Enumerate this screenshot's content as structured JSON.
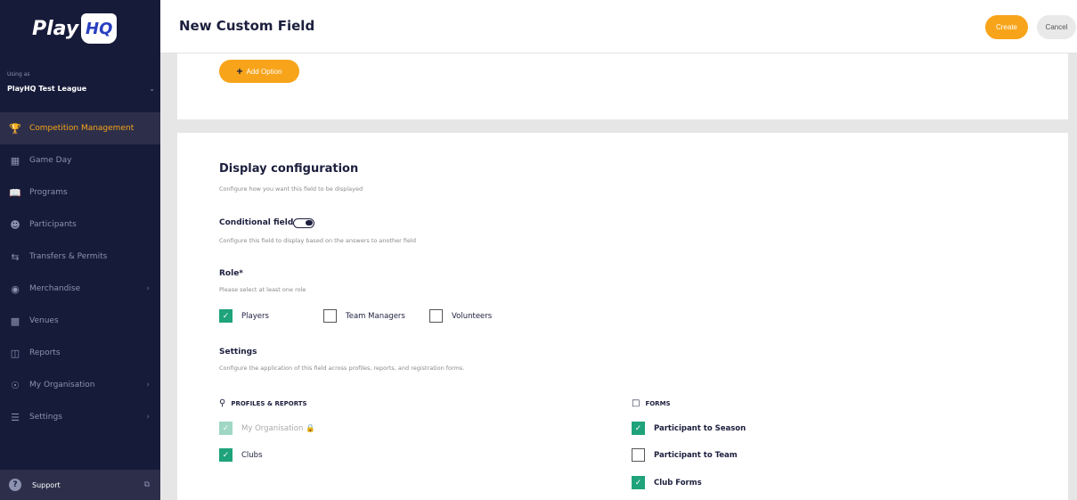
{
  "sidebar": {
    "logo_text": "Play",
    "logo_badge": "HQ",
    "using_as_label": "Using as",
    "org_name": "PlayHQ Test League",
    "items": [
      {
        "label": "Competition Management",
        "icon": "trophy-icon",
        "active": true
      },
      {
        "label": "Game Day",
        "icon": "scoreboard-icon"
      },
      {
        "label": "Programs",
        "icon": "book-icon"
      },
      {
        "label": "Participants",
        "icon": "people-icon"
      },
      {
        "label": "Transfers & Permits",
        "icon": "transfer-arrows-icon"
      },
      {
        "label": "Merchandise",
        "icon": "shirt-icon",
        "expandable": true
      },
      {
        "label": "Venues",
        "icon": "stadium-icon"
      },
      {
        "label": "Reports",
        "icon": "chart-icon"
      },
      {
        "label": "My Organisation",
        "icon": "globe-icon",
        "expandable": true
      },
      {
        "label": "Settings",
        "icon": "sliders-icon",
        "expandable": true
      }
    ],
    "support_label": "Support"
  },
  "header": {
    "title": "New Custom Field",
    "create_label": "Create",
    "cancel_label": "Cancel"
  },
  "options_card": {
    "add_option_label": "Add Option"
  },
  "display_config": {
    "title": "Display configuration",
    "subtitle": "Configure how you want this field to be displayed",
    "conditional_label": "Conditional field",
    "conditional_desc": "Configure this field to display based on the answers to another field",
    "role_label": "Role*",
    "role_desc": "Please select at least one role",
    "roles": [
      {
        "label": "Players",
        "checked": true
      },
      {
        "label": "Team Managers",
        "checked": false
      },
      {
        "label": "Volunteers",
        "checked": false
      }
    ],
    "settings_label": "Settings",
    "settings_desc": "Configure the application of this field across profiles, reports, and registration forms.",
    "profiles_header": "PROFILES & REPORTS",
    "profiles": [
      {
        "label": "My Organisation",
        "checked": true,
        "disabled": true
      },
      {
        "label": "Clubs",
        "checked": true
      }
    ],
    "forms_header": "FORMS",
    "forms": [
      {
        "label": "Participant to Season",
        "checked": true
      },
      {
        "label": "Participant to Team",
        "checked": false
      },
      {
        "label": "Club Forms",
        "checked": true
      }
    ]
  },
  "colors": {
    "sidebar_bg": "#171b3a",
    "accent": "#f7a41a",
    "check_green": "#1fa37a"
  }
}
